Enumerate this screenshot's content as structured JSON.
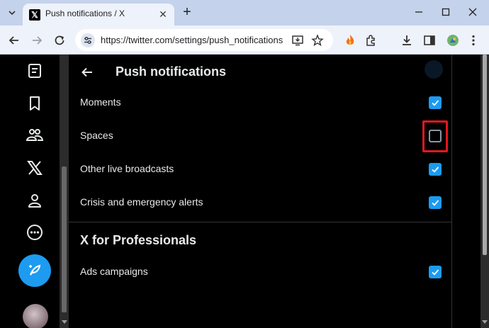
{
  "browser": {
    "tab": {
      "title": "Push notifications / X",
      "favicon_icon": "x-logo-icon",
      "close_label": "✕"
    },
    "new_tab_label": "+",
    "url": "https://twitter.com/settings/push_notifications"
  },
  "page": {
    "title": "Push notifications",
    "back_icon": "arrow-left-icon"
  },
  "settings": [
    {
      "label": "Moments",
      "checked": true
    },
    {
      "label": "Spaces",
      "checked": false,
      "highlighted": true
    },
    {
      "label": "Other live broadcasts",
      "checked": true
    },
    {
      "label": "Crisis and emergency alerts",
      "checked": true
    }
  ],
  "professionals_section": {
    "title": "X for Professionals",
    "settings": [
      {
        "label": "Ads campaigns",
        "checked": true
      }
    ]
  },
  "sidebar": {
    "items": [
      "lists-icon",
      "bookmark-icon",
      "communities-icon",
      "x-premium-icon",
      "profile-icon",
      "more-icon"
    ],
    "post_button_icon": "compose-icon"
  },
  "colors": {
    "accent": "#1d9bf0",
    "highlight": "#e3181e",
    "background": "#000000",
    "text": "#e7e9ea"
  }
}
